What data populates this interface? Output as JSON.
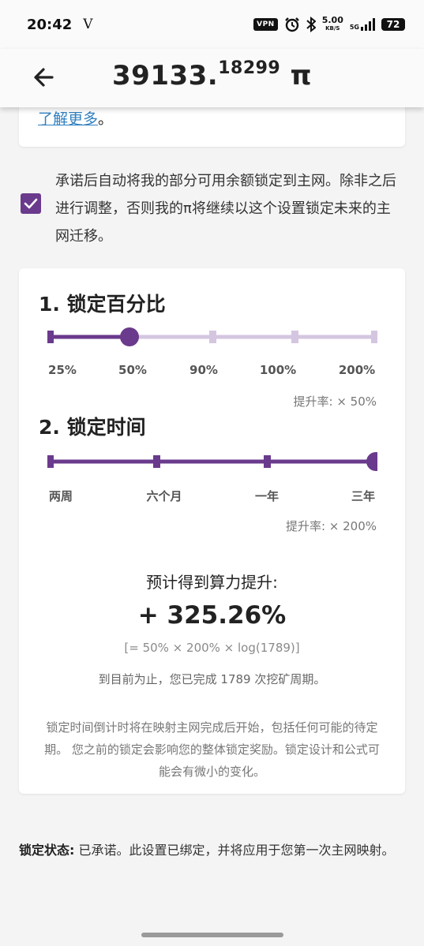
{
  "status_bar": {
    "time": "20:42",
    "carrier_icon": "V",
    "vpn": "VPN",
    "speed": "5.00",
    "speed_unit": "KB/S",
    "network": "5G",
    "battery": "72"
  },
  "header": {
    "balance_main": "39133.",
    "balance_decimal": "18299",
    "currency": "π"
  },
  "top_card": {
    "learn_more": "了解更多",
    "suffix": "。"
  },
  "commitment": {
    "checked": true,
    "text": "承诺后自动将我的部分可用余额锁定到主网。除非之后进行调整，否则我的π将继续以这个设置锁定未来的主网迁移。"
  },
  "lock_percentage": {
    "title": "1. 锁定百分比",
    "options": [
      "25%",
      "50%",
      "90%",
      "100%",
      "200%"
    ],
    "selected_index": 1,
    "boost_label": "提升率: × 50%"
  },
  "lock_time": {
    "title": "2. 锁定时间",
    "options": [
      "两周",
      "六个月",
      "一年",
      "三年"
    ],
    "selected_index": 3,
    "boost_label": "提升率: × 200%"
  },
  "estimate": {
    "title": "预计得到算力提升:",
    "value": "+ 325.26%",
    "formula": "[= 50% × 200% × log(1789)]",
    "mined_text": "到目前为止，您已完成 1789 次挖矿周期。"
  },
  "note": "锁定时间倒计时将在映射主网完成后开始，包括任何可能的待定期。 您之前的锁定会影响您的整体锁定奖励。锁定设计和公式可能会有微小的变化。",
  "lock_status": {
    "label": "锁定状态:",
    "text": " 已承诺。此设置已绑定，并将应用于您第一次主网映射。"
  },
  "colors": {
    "accent": "#6a3a8c",
    "track_light": "#d4c6e0",
    "link": "#2f7fc0"
  }
}
